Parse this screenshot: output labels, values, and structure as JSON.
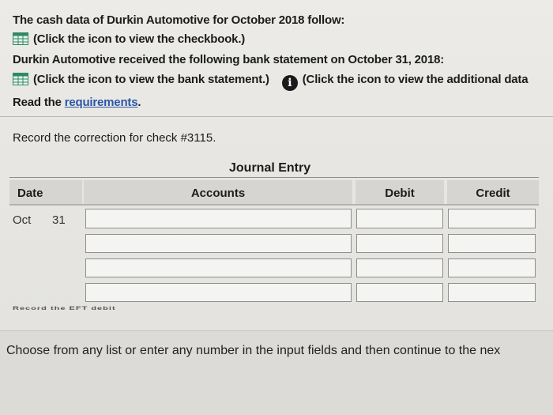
{
  "intro": {
    "line1": "The cash data of Durkin Automotive for October 2018 follow:",
    "line2": "(Click the icon to view the checkbook.)",
    "line3": "Durkin Automotive received the following bank statement on October 31, 2018:",
    "line4": "(Click the icon to view the bank statement.)",
    "line4b": "(Click the icon to view the additional data",
    "line5_prefix": "Read the ",
    "line5_link": "requirements",
    "line5_suffix": "."
  },
  "question": "Record the correction for check #3115.",
  "journal": {
    "title": "Journal Entry",
    "headers": {
      "date": "Date",
      "accounts": "Accounts",
      "debit": "Debit",
      "credit": "Credit"
    },
    "month": "Oct",
    "day": "31",
    "rows": [
      {
        "account": "",
        "debit": "",
        "credit": ""
      },
      {
        "account": "",
        "debit": "",
        "credit": ""
      },
      {
        "account": "",
        "debit": "",
        "credit": ""
      },
      {
        "account": "",
        "debit": "",
        "credit": ""
      }
    ]
  },
  "partial_text": "Record the EFT debit",
  "footer_text": "Choose from any list or enter any number in the input fields and then continue to the nex",
  "icons": {
    "checkbook": "grid-icon",
    "bank_statement": "grid-icon",
    "info": "info-icon"
  },
  "colors": {
    "link": "#2a56a8",
    "icon_grid": "#2f8a63"
  }
}
